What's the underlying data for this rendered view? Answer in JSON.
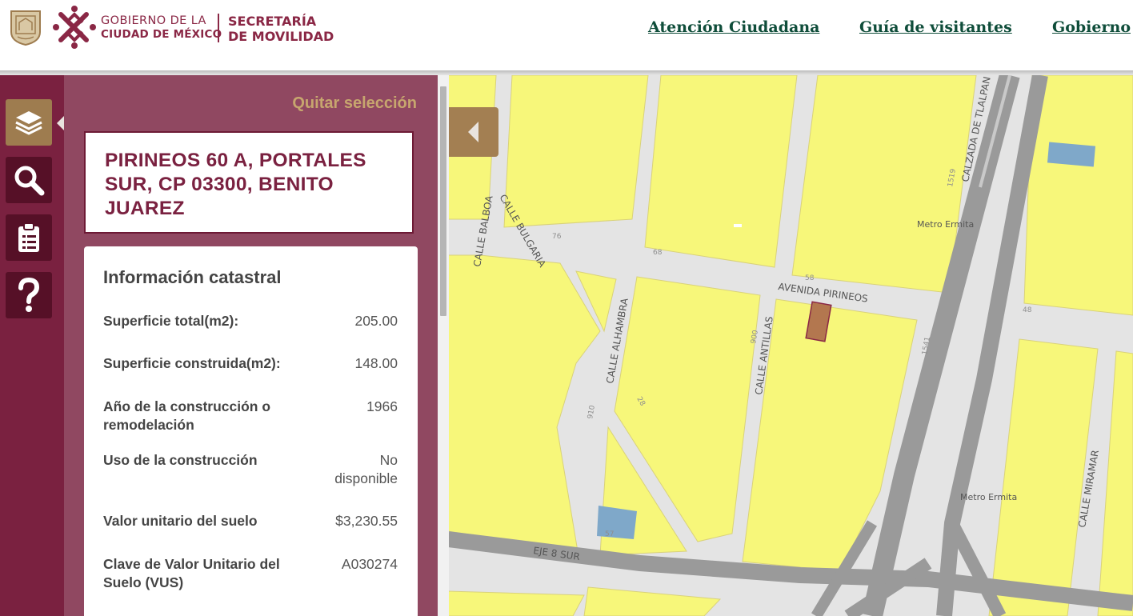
{
  "header": {
    "logo": {
      "gov_line1": "GOBIERNO DE LA",
      "gov_line2": "CIUDAD DE MÉXICO",
      "sec_line1": "SECRETARÍA",
      "sec_line2": "DE MOVILIDAD",
      "color": "#8a2745"
    },
    "nav": [
      {
        "label": "Atención Ciudadana"
      },
      {
        "label": "Guía de visitantes"
      },
      {
        "label": "Gobierno"
      }
    ],
    "nav_color": "#0f4d3a"
  },
  "toolbar": {
    "tools": [
      {
        "icon": "layers-icon",
        "active": true
      },
      {
        "icon": "search-icon",
        "active": false
      },
      {
        "icon": "clipboard-icon",
        "active": false
      },
      {
        "icon": "help-icon",
        "active": false
      }
    ]
  },
  "panel": {
    "clear_selection": "Quitar selección",
    "address": "PIRINEOS 60 A, PORTALES SUR, CP 03300, BENITO JUAREZ",
    "info": {
      "title": "Información catastral",
      "rows": [
        {
          "label": "Superficie total(m2):",
          "value": "205.00"
        },
        {
          "label": "Superficie construida(m2):",
          "value": "148.00"
        },
        {
          "label": "Año de la construcción o remodelación",
          "value": "1966"
        },
        {
          "label": "Uso de la construcción",
          "value": "No disponible"
        },
        {
          "label": "Valor unitario del suelo",
          "value": "$3,230.55"
        },
        {
          "label": "Clave de Valor Unitario del Suelo (VUS)",
          "value": "A030274"
        }
      ]
    }
  },
  "map": {
    "street_labels": {
      "balboa": "CALLE BALBOA",
      "bulgaria": "CALLE BULGARIA",
      "alhambra": "CALLE ALHAMBRA",
      "antillas": "CALLE ANTILLAS",
      "pirineos": "AVENIDA PIRINEOS",
      "tlalpan": "CALZADA DE TLALPAN",
      "miramar": "CALLE MIRAMAR",
      "eje8": "EJE 8 SUR",
      "metro1": "Metro Ermita",
      "metro2": "Metro Ermita"
    },
    "numbers": {
      "n1": "76",
      "n2": "68",
      "n3": "58",
      "n4": "48",
      "n5": "1519",
      "n6": "1541",
      "n7": "900",
      "n8": "910",
      "n9": "28",
      "n10": "57"
    },
    "colors": {
      "block": "#f7f77a",
      "road": "#e4e4e4",
      "highway": "#9a9a9a",
      "selected_parcel": "#b3774f",
      "water": "#7fa8c9"
    }
  }
}
